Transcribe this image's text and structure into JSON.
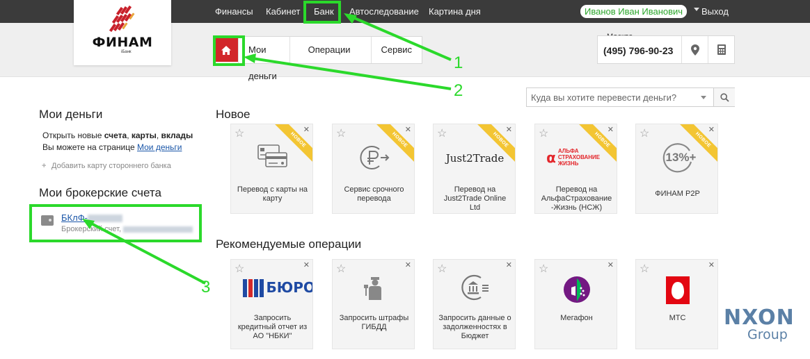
{
  "topnav": {
    "items": [
      "Финансы",
      "Кабинет",
      "Банк",
      "Автоследование",
      "Картина дня"
    ],
    "user": "Иванов Иван Иванович",
    "logout": "Выход"
  },
  "logo": {
    "brand": "ФИНАМ",
    "sub": "iБанк"
  },
  "tabs": [
    "Мои деньги",
    "Операции",
    "Сервис"
  ],
  "contact": {
    "city": "Москва",
    "phone": "(495) 796-90-23"
  },
  "search": {
    "placeholder": "Куда вы хотите перевести деньги?"
  },
  "left": {
    "money_title": "Мои деньги",
    "open_prefix": "Открыть новые ",
    "open_items": [
      "счета",
      "карты",
      "вклады"
    ],
    "page_prefix": "Вы можете на странице ",
    "page_link": "Мои деньги",
    "add_card": "Добавить карту стороннего банка",
    "broker_title": "Мои брокерские счета",
    "account_name": "БКлФ-",
    "account_sub": "Брокерский счет,"
  },
  "sections": {
    "new_title": "Новое",
    "recommended_title": "Рекомендуемые операции",
    "badge": "НОВОЕ",
    "new_cards": [
      {
        "label": "Перевод с карты на карту",
        "icon": "cards-icon"
      },
      {
        "label": "Сервис срочного перевода",
        "icon": "ruble-transfer-icon"
      },
      {
        "label": "Перевод на Just2Trade Online Ltd",
        "icon": "just2trade-logo",
        "logo_text": "Just2Trade"
      },
      {
        "label": "Перевод на АльфаСтрахование -Жизнь (НСЖ)",
        "icon": "alfa-logo",
        "logo_text": "АЛЬФА СТРАХОВАНИЕ ЖИЗНЬ"
      },
      {
        "label": "ФИНАМ P2P",
        "icon": "percent-icon",
        "logo_text": "13%+"
      }
    ],
    "rec_cards": [
      {
        "label": "Запросить кредитный отчет из АО \"НБКИ\"",
        "icon": "nbki-logo",
        "logo_text": "БЮРО"
      },
      {
        "label": "Запросить штрафы ГИБДД",
        "icon": "traffic-police-icon"
      },
      {
        "label": "Запросить данные о задолженностях в Бюджет",
        "icon": "budget-icon"
      },
      {
        "label": "Мегафон",
        "icon": "megafon-logo"
      },
      {
        "label": "МТС",
        "icon": "mts-logo"
      }
    ]
  },
  "annotations": [
    "1",
    "2",
    "3"
  ],
  "watermark": {
    "top": "NXON",
    "bottom": "Group"
  },
  "colors": {
    "accent_red": "#d2262a",
    "annotation_green": "#2bd92b",
    "badge_yellow": "#f3c533",
    "link_blue": "#1a56a8"
  }
}
